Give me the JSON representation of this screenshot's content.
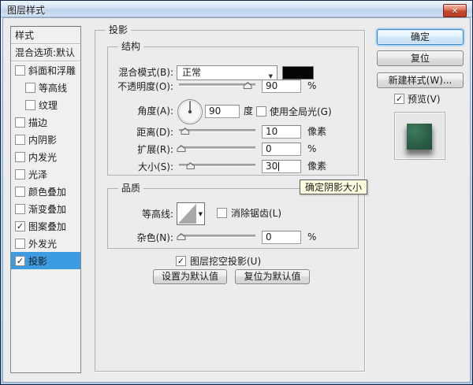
{
  "window": {
    "title": "图层样式"
  },
  "icons": {
    "close": "✕",
    "dropdown": "▼",
    "check": "✓"
  },
  "colors": {
    "selection_blue": "#3d9be2",
    "blend_swatch": "#000000",
    "preview_green": "#2c5f47",
    "tooltip_bg": "#ffffe1",
    "dialog_bg": "#ececec"
  },
  "sidebar": {
    "items": [
      {
        "label": "样式",
        "check": null,
        "selected": false
      },
      {
        "label": "混合选项:默认",
        "check": null,
        "selected": false
      },
      {
        "label": "斜面和浮雕",
        "check": "",
        "selected": false
      },
      {
        "label": "等高线",
        "check": "",
        "selected": false,
        "indent": 1
      },
      {
        "label": "纹理",
        "check": "",
        "selected": false,
        "indent": 1
      },
      {
        "label": "描边",
        "check": "",
        "selected": false
      },
      {
        "label": "内阴影",
        "check": "",
        "selected": false
      },
      {
        "label": "内发光",
        "check": "",
        "selected": false
      },
      {
        "label": "光泽",
        "check": "",
        "selected": false
      },
      {
        "label": "颜色叠加",
        "check": "",
        "selected": false
      },
      {
        "label": "渐变叠加",
        "check": "",
        "selected": false
      },
      {
        "label": "图案叠加",
        "check": "✓",
        "selected": false
      },
      {
        "label": "外发光",
        "check": "",
        "selected": false
      },
      {
        "label": "投影",
        "check": "✓",
        "selected": true
      }
    ]
  },
  "panel": {
    "title": "投影",
    "structure": {
      "title": "结构",
      "blend_mode": {
        "label": "混合模式(B):",
        "value": "正常"
      },
      "opacity": {
        "label": "不透明度(O):",
        "value": "90",
        "unit": "%",
        "pct": 90
      },
      "angle": {
        "label": "角度(A):",
        "value": "90",
        "unit": "度",
        "use_global_label": "使用全局光(G)",
        "use_global_check": ""
      },
      "distance": {
        "label": "距离(D):",
        "value": "10",
        "unit": "像素",
        "pct": 8
      },
      "spread": {
        "label": "扩展(R):",
        "value": "0",
        "unit": "%",
        "pct": 3
      },
      "size": {
        "label": "大小(S):",
        "value": "30",
        "unit": "像素",
        "pct": 15
      }
    },
    "quality": {
      "title": "品质",
      "contour": {
        "label": "等高线:",
        "antialias_label": "消除锯齿(L)",
        "antialias_check": ""
      },
      "noise": {
        "label": "杂色(N):",
        "value": "0",
        "unit": "%",
        "pct": 3
      }
    },
    "knockout": {
      "label": "图层挖空投影(U)",
      "check": "✓"
    },
    "defaults": {
      "make": "设置为默认值",
      "reset": "复位为默认值"
    }
  },
  "actions": {
    "ok": "确定",
    "reset": "复位",
    "new_style": "新建样式(W)...",
    "preview_label": "预览(V)",
    "preview_check": "✓"
  },
  "tooltip": {
    "text": "确定阴影大小"
  }
}
